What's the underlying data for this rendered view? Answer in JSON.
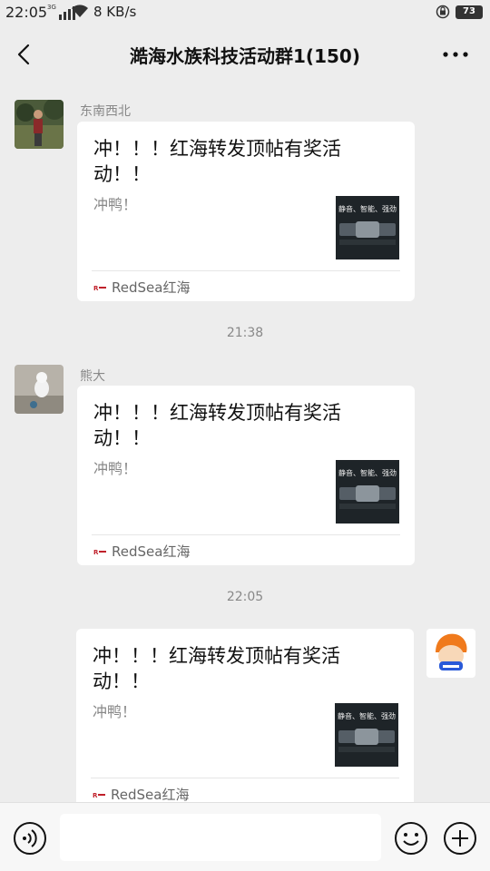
{
  "status_bar": {
    "time": "22:05",
    "network": "3G",
    "speed": "8 KB/s",
    "battery": "73"
  },
  "header": {
    "title": "澔海水族科技活动群1(150)"
  },
  "messages": [
    {
      "sender": "东南西北",
      "card": {
        "title": "冲！！！红海转发顶帖有奖活动！！",
        "desc": "冲鸭！",
        "thumb_text": "静音、智能、强劲",
        "source": "RedSea红海"
      }
    },
    {
      "sender": "熊大",
      "card": {
        "title": "冲！！！红海转发顶帖有奖活动！！",
        "desc": "冲鸭！",
        "thumb_text": "静音、智能、强劲",
        "source": "RedSea红海"
      }
    },
    {
      "sender": "",
      "card": {
        "title": "冲！！！红海转发顶帖有奖活动！！",
        "desc": "冲鸭！",
        "thumb_text": "静音、智能、强劲",
        "source": "RedSea红海"
      }
    }
  ],
  "timestamps": [
    "21:38",
    "22:05"
  ],
  "colors": {
    "background": "#ededed",
    "card": "#ffffff",
    "muted_text": "#888888"
  }
}
